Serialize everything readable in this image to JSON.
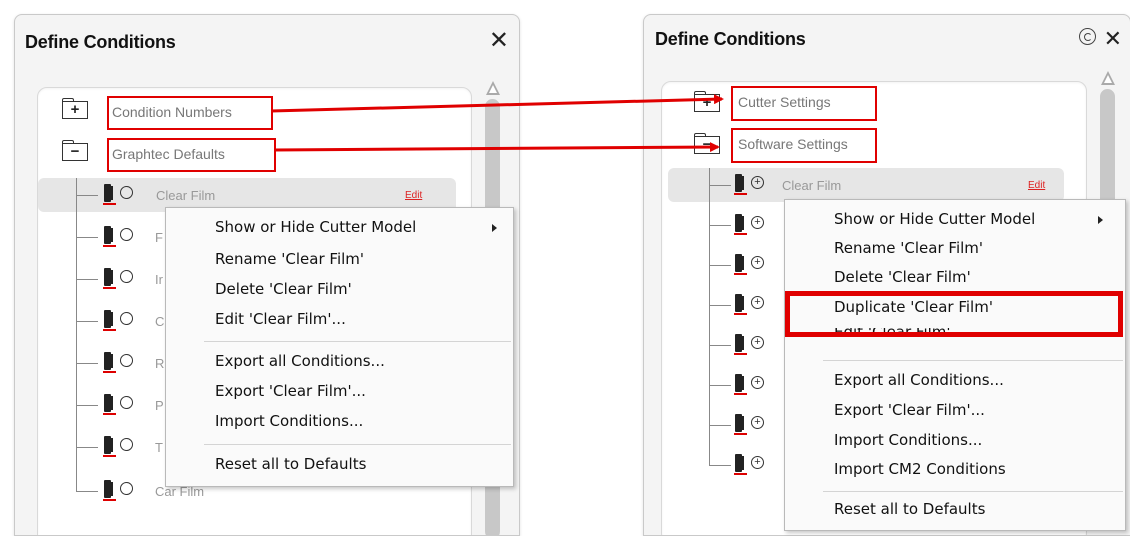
{
  "left_window": {
    "title": "Define Conditions",
    "close_icon": "close-icon",
    "folders": [
      {
        "label": "Condition Numbers",
        "sign": "+"
      },
      {
        "label": "Graphtec Defaults",
        "sign": "−"
      }
    ],
    "items": [
      "Clear Film",
      "F",
      "Ir",
      "C",
      "R",
      "P",
      "T",
      "Car Film"
    ],
    "edit_label": "Edit",
    "menu": {
      "items": [
        "Show or Hide Cutter Model",
        "Rename 'Clear Film'",
        "Delete 'Clear Film'",
        "Edit 'Clear Film'...",
        "Export all Conditions...",
        "Export 'Clear Film'...",
        "Import Conditions...",
        "Reset all to Defaults"
      ]
    }
  },
  "right_window": {
    "title": "Define Conditions",
    "refresh_icon": "refresh-icon",
    "close_icon": "close-icon",
    "folders": [
      {
        "label": "Cutter Settings",
        "sign": "+"
      },
      {
        "label": "Software Settings",
        "sign": "−"
      }
    ],
    "items": [
      "Clear Film"
    ],
    "edit_label": "Edit",
    "menu": {
      "items": [
        "Show or Hide Cutter Model",
        "Rename 'Clear Film'",
        "Delete 'Clear Film'",
        "Duplicate 'Clear Film'",
        "Edit 'Clear Film'...",
        "Export all Conditions...",
        "Export 'Clear Film'...",
        "Import Conditions...",
        "Import CM2 Conditions",
        "Reset all to Defaults"
      ]
    }
  },
  "colors": {
    "highlight": "#e00000",
    "accent_red": "#d22222",
    "menu_bg": "#fafafa"
  }
}
